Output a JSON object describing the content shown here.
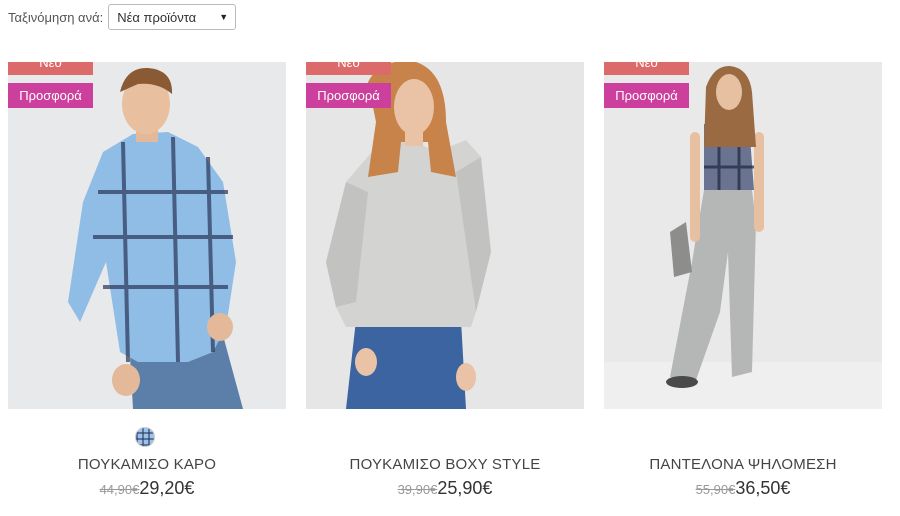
{
  "sort": {
    "label": "Ταξινόμηση ανά:",
    "selected": "Νέα προϊόντα",
    "arrow_icon": "triangle-down"
  },
  "badges": {
    "new": "Νέο",
    "sale": "Προσφορά",
    "new_color": "#dd6a6a",
    "sale_color": "#cc3f9c"
  },
  "products": [
    {
      "name": "ΠΟΥΚΑΜΙΣΟ ΚΑΡΟ",
      "old_price": "44,90€",
      "price": "29,20€",
      "has_swatch": true
    },
    {
      "name": "ΠΟΥΚΑΜΙΣΟ BOXY STYLE",
      "old_price": "39,90€",
      "price": "25,90€",
      "has_swatch": false
    },
    {
      "name": "ΠΑΝΤΕΛΟΝΑ ΨΗΛΟΜΕΣΗ",
      "old_price": "55,90€",
      "price": "36,50€",
      "has_swatch": false
    }
  ]
}
